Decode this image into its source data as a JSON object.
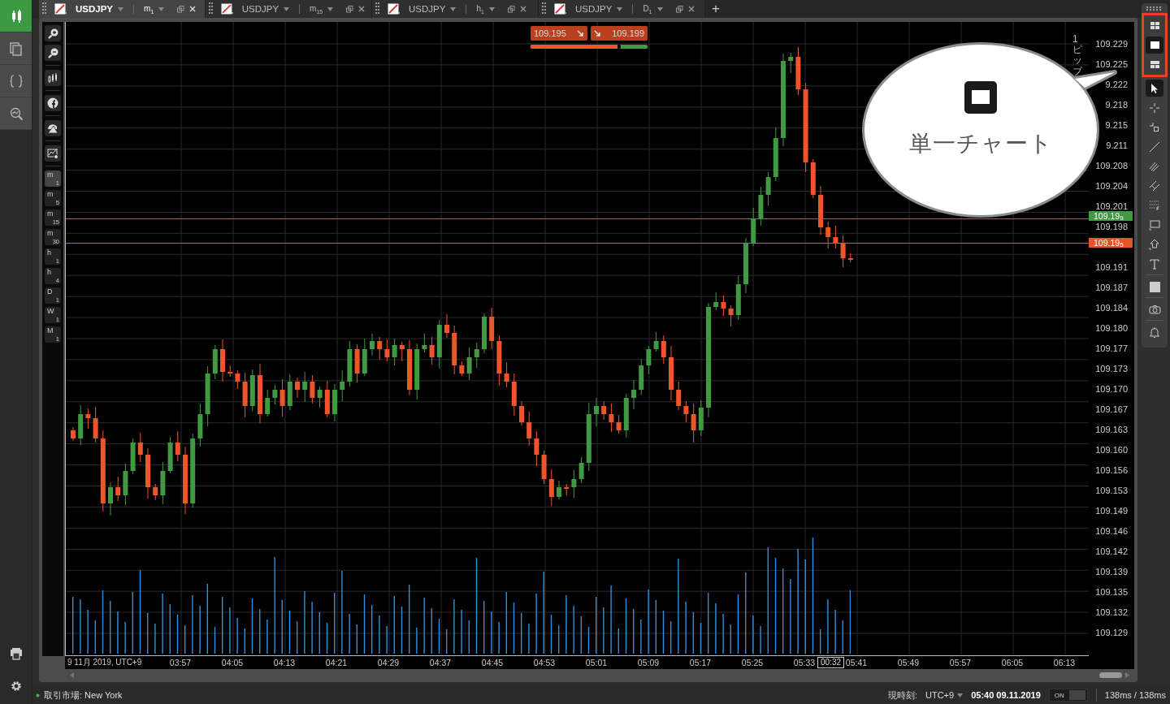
{
  "sidebar": {
    "items": [
      {
        "selected": true
      },
      {
        "selected": false
      },
      {
        "selected": false
      },
      {
        "selected": false
      }
    ]
  },
  "tabs": [
    {
      "symbol": "USDJPY",
      "timeframe": "m",
      "timeframe_sub": "1",
      "selected": true
    },
    {
      "symbol": "USDJPY",
      "timeframe": "m",
      "timeframe_sub": "15",
      "selected": false
    },
    {
      "symbol": "USDJPY",
      "timeframe": "h",
      "timeframe_sub": "1",
      "selected": false
    },
    {
      "symbol": "USDJPY",
      "timeframe": "D",
      "timeframe_sub": "1",
      "selected": false
    }
  ],
  "add_tab": "+",
  "timeframe_buttons": [
    {
      "label": "m",
      "sub": "1",
      "selected": true
    },
    {
      "label": "m",
      "sub": "5",
      "selected": false
    },
    {
      "label": "m",
      "sub": "15",
      "selected": false
    },
    {
      "label": "m",
      "sub": "30",
      "selected": false
    },
    {
      "label": "h",
      "sub": "1",
      "selected": false
    },
    {
      "label": "h",
      "sub": "4",
      "selected": false
    },
    {
      "label": "D",
      "sub": "1",
      "selected": false
    },
    {
      "label": "W",
      "sub": "1",
      "selected": false
    },
    {
      "label": "M",
      "sub": "1",
      "selected": false
    }
  ],
  "quote": {
    "bid": "109.195",
    "ask": "109.199",
    "level": 0.77
  },
  "pip_label": "1ピップ",
  "price_axis": {
    "ticks": [
      "109.229",
      "109.225",
      "9.222",
      "9.218",
      "9.215",
      "9.211",
      "109.208",
      "109.204",
      "109.201",
      "109.198",
      "109.191",
      "109.187",
      "109.184",
      "109.180",
      "109.177",
      "109.173",
      "109.170",
      "109.167",
      "109.163",
      "109.160",
      "109.156",
      "109.153",
      "109.149",
      "109.146",
      "109.142",
      "109.139",
      "109.135",
      "109.132",
      "109.129"
    ]
  },
  "price_lines": [
    {
      "label": "109.19$_{9}$",
      "color": "#3f9a41"
    },
    {
      "label": "109.19$_{5}$",
      "color": "#e8542a"
    }
  ],
  "time_axis": {
    "date_label": "9 11月 2019, UTC+9",
    "ticks": [
      "03:57",
      "04:05",
      "04:13",
      "04:21",
      "04:29",
      "04:37",
      "04:45",
      "04:53",
      "05:01",
      "05:09",
      "05:17",
      "05:25",
      "05:33",
      "05:41",
      "05:49",
      "05:57",
      "06:05",
      "06:13"
    ],
    "cursor_label": "00:32"
  },
  "callout": {
    "text": "単一チャート"
  },
  "layout_buttons": [
    {
      "selected": false
    },
    {
      "selected": true
    },
    {
      "selected": false
    }
  ],
  "status_bar": {
    "market": "取引市場: New York",
    "time_label": "現時刻:",
    "timezone": "UTC+9",
    "datetime": "05:40 09.11.2019",
    "toggle": {
      "label": "ON",
      "on": false
    },
    "latency": "138ms / 138ms"
  }
}
